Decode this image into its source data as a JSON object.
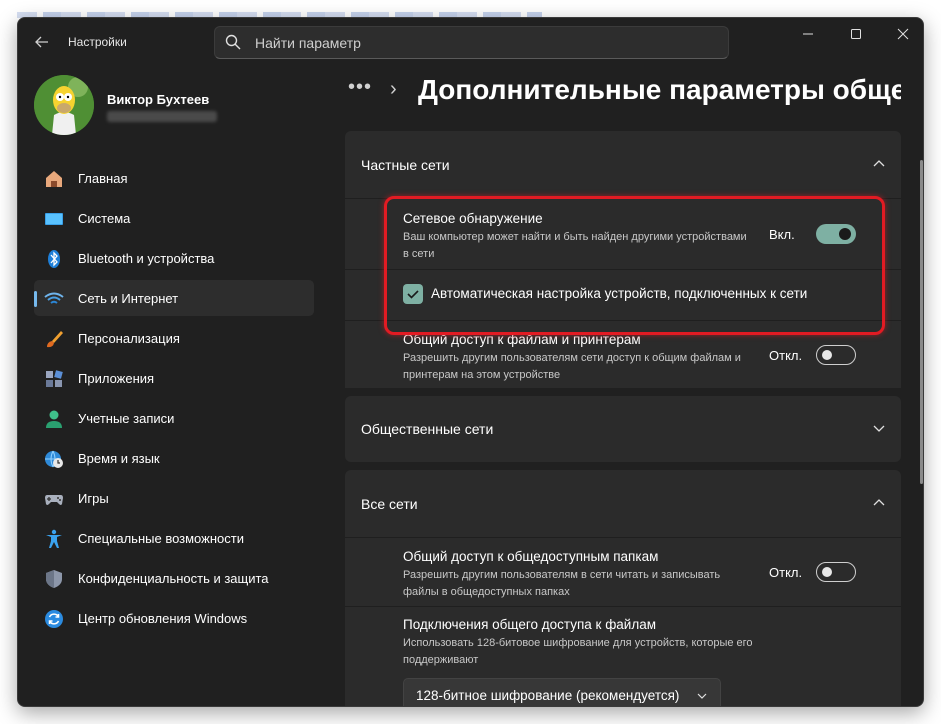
{
  "window": {
    "app_title": "Настройки",
    "search_placeholder": "Найти параметр"
  },
  "user": {
    "name": "Виктор Бухтеев"
  },
  "nav": {
    "items": [
      {
        "label": "Главная",
        "icon": "home-icon"
      },
      {
        "label": "Система",
        "icon": "system-icon"
      },
      {
        "label": "Bluetooth и устройства",
        "icon": "bluetooth-icon"
      },
      {
        "label": "Сеть и Интернет",
        "icon": "wifi-icon",
        "active": true
      },
      {
        "label": "Персонализация",
        "icon": "brush-icon"
      },
      {
        "label": "Приложения",
        "icon": "apps-icon"
      },
      {
        "label": "Учетные записи",
        "icon": "account-icon"
      },
      {
        "label": "Время и язык",
        "icon": "globe-clock-icon"
      },
      {
        "label": "Игры",
        "icon": "gamepad-icon"
      },
      {
        "label": "Специальные возможности",
        "icon": "accessibility-icon"
      },
      {
        "label": "Конфиденциальность и защита",
        "icon": "shield-icon"
      },
      {
        "label": "Центр обновления Windows",
        "icon": "update-icon"
      }
    ]
  },
  "header": {
    "dots": "•••",
    "separator": "›",
    "title": "Дополнительные параметры общего доступа"
  },
  "private": {
    "title": "Частные сети",
    "discovery_title": "Сетевое обнаружение",
    "discovery_desc": "Ваш компьютер может найти и быть найден другими устройствами в сети",
    "discovery_state": "Вкл.",
    "discovery_on": true,
    "auto_setup_label": "Автоматическая настройка устройств, подключенных к сети",
    "auto_setup_checked": true,
    "sharing_title": "Общий доступ к файлам и принтерам",
    "sharing_desc": "Разрешить другим пользователям сети доступ к общим файлам и принтерам на этом устройстве",
    "sharing_state": "Откл.",
    "sharing_on": false
  },
  "public": {
    "title": "Общественные сети"
  },
  "all": {
    "title": "Все сети",
    "public_folders_title": "Общий доступ к общедоступным папкам",
    "public_folders_desc": "Разрешить другим пользователям в сети читать и записывать файлы в общедоступных папках",
    "public_folders_state": "Откл.",
    "public_folders_on": false,
    "connections_title": "Подключения общего доступа к файлам",
    "connections_desc": "Использовать 128-битовое шифрование для устройств, которые его поддерживают",
    "encryption_selected": "128-битное шифрование (рекомендуется)"
  },
  "colors": {
    "accent": "#7eb0a3",
    "highlight": "#e21b23",
    "nav_indicator": "#76b9ed"
  }
}
